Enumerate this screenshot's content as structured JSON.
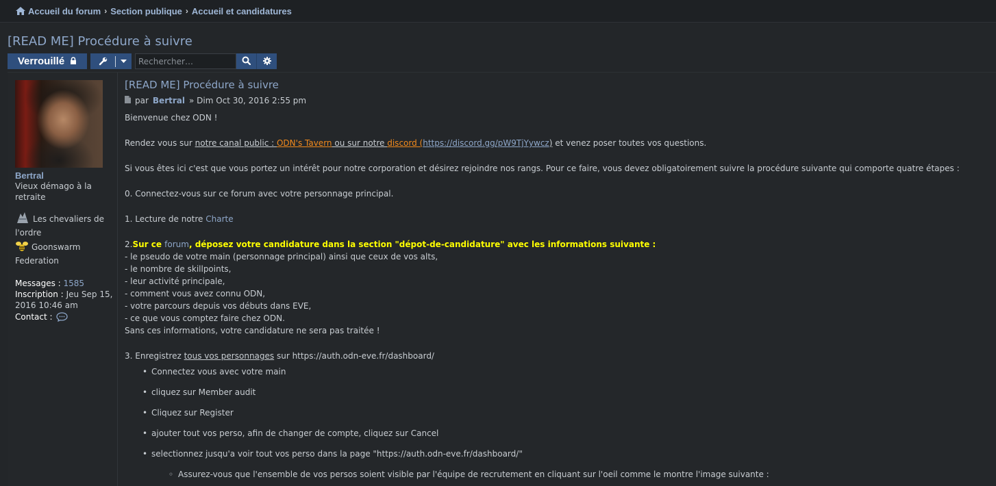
{
  "breadcrumbs": {
    "items": [
      "Accueil du forum",
      "Section publique",
      "Accueil et candidatures"
    ]
  },
  "topic": {
    "title": "[READ ME] Procédure à suivre",
    "locked_label": "Verrouillé",
    "search_placeholder": "Rechercher…"
  },
  "author": {
    "name": "Bertral",
    "rank": "Vieux démago à la retraite",
    "badge1": "Les chevaliers de l'ordre",
    "badge2": "Goonswarm Federation",
    "messages_label": "Messages :",
    "messages_value": "1585",
    "inscription_label": "Inscription :",
    "inscription_value": "Jeu Sep 15, 2016 10:46 am",
    "contact_label": "Contact :"
  },
  "post": {
    "title": "[READ ME] Procédure à suivre",
    "by": "par",
    "author": "Bertral",
    "date": "» Dim Oct 30, 2016 2:55 pm",
    "welcome": "Bienvenue chez ODN !",
    "line_rendez": "Rendez vous sur ",
    "canal_public": "notre canal public : ",
    "odn_tavern": "ODN's Tavern",
    "ou_sur_notre": " ou sur notre ",
    "discord": "discord (",
    "discord_url": "https://discord.gg/pW9TjYywcz",
    "discord_close": ")",
    "venez": " et venez poser toutes vos questions.",
    "intro": "Si vous êtes ici c'est que vous portez un intérêt pour notre corporation et désirez rejoindre nos rangs. Pour ce faire, vous devez obligatoirement suivre la procédure suivante qui comporte quatre étapes :",
    "step0": "0. Connectez-vous sur ce forum avec votre personnage principal.",
    "step1_prefix": "1. Lecture de notre ",
    "step1_link": "Charte",
    "step2_num": "2.",
    "step2_a": "Sur ce ",
    "step2_link": "forum",
    "step2_b": ", déposez votre candidature dans la section \"dépot-de-candidature\" avec les informations suivante :",
    "step2_items": [
      "- le pseudo de votre main (personnage principal) ainsi que ceux de vos alts,",
      "- le nombre de skillpoints,",
      "- leur activité principale,",
      "- comment vous avez connu ODN,",
      "- votre parcours depuis vos débuts dans EVE,",
      "- ce que vous comptez faire chez ODN."
    ],
    "step2_warning": "Sans ces informations, votre candidature ne sera pas traitée !",
    "step3_prefix": "3. Enregistrez ",
    "step3_under": "tous vos personnages",
    "step3_suffix": " sur https://auth.odn-eve.fr/dashboard/",
    "step3_bullets": [
      "Connectez vous avec votre main",
      "cliquez sur Member audit",
      "Cliquez sur Register",
      "ajouter tout vos perso, afin de changer de compte, cliquez sur Cancel",
      "selectionnez jusqu'a voir tout vos perso dans la page \"https://auth.odn-eve.fr/dashboard/\""
    ],
    "step3_sub": "Assurez-vous que l'ensemble de vos persos soient visible par l'équipe de recrutement en cliquant sur l'oeil comme le montre l'image suivante :"
  },
  "colors": {
    "accent": "#2f4f7d",
    "link": "#8ea7c9",
    "highlight_yellow": "#ffff00",
    "orange_link": "#f28a1c"
  }
}
